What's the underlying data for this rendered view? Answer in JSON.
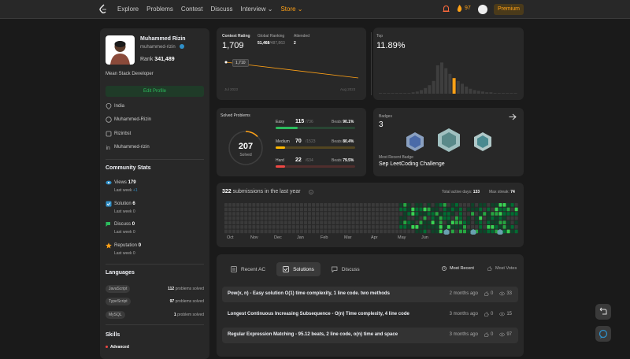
{
  "nav": {
    "links": [
      "Explore",
      "Problems",
      "Contest",
      "Discuss",
      "Interview ⌄",
      "Store ⌄"
    ],
    "streak": "97",
    "premium": "Premium"
  },
  "profile": {
    "name": "Muhammed Rizin",
    "username": "muhammed-rizin",
    "rank_label": "Rank",
    "rank": "341,489",
    "bio": "Mean Stack Developer",
    "edit": "Edit Profile",
    "location": "India",
    "github": "Muhammed-Rizin",
    "twitter": "Rizinbst",
    "linkedin": "Muhammed-rizin"
  },
  "community": {
    "title": "Community Stats",
    "items": [
      {
        "label": "Views",
        "value": "179",
        "sub": "Last week",
        "delta": "+1"
      },
      {
        "label": "Solution",
        "value": "6",
        "sub": "Last week",
        "delta": "0"
      },
      {
        "label": "Discuss",
        "value": "0",
        "sub": "Last week",
        "delta": "0"
      },
      {
        "label": "Reputation",
        "value": "0",
        "sub": "Last week",
        "delta": "0"
      }
    ]
  },
  "languages": {
    "title": "Languages",
    "items": [
      {
        "name": "JavaScript",
        "count": "112",
        "suffix": "problems solved"
      },
      {
        "name": "TypeScript",
        "count": "97",
        "suffix": "problems solved"
      },
      {
        "name": "MySQL",
        "count": "1",
        "suffix": "problem solved"
      }
    ]
  },
  "skills": {
    "title": "Skills",
    "level": "Advanced"
  },
  "contest": {
    "rating_label": "Contest Rating",
    "rating": "1,709",
    "global_label": "Global Ranking",
    "global": "51,468",
    "global_total": "/487,863",
    "attended_label": "Attended",
    "attended": "2",
    "point_label": "1,710",
    "start": "Jul 2023",
    "end": "Aug 2023"
  },
  "top": {
    "label": "Top",
    "value": "11.89%"
  },
  "solved": {
    "title": "Solved Problems",
    "total": "207",
    "sub": "Solved",
    "rows": [
      {
        "name": "Easy",
        "count": "115",
        "of": "/736",
        "beats_label": "Beats",
        "beats": "90.1%",
        "color": "#2cbb5d",
        "fraction": 0.156
      },
      {
        "name": "Medium",
        "count": "70",
        "of": "/1523",
        "beats_label": "Beats",
        "beats": "80.4%",
        "color": "#ffb800",
        "fraction": 0.046
      },
      {
        "name": "Hard",
        "count": "22",
        "of": "/634",
        "beats_label": "Beats",
        "beats": "79.5%",
        "color": "#ef4743",
        "fraction": 0.035
      }
    ]
  },
  "badges": {
    "label": "Badges",
    "count": "3",
    "recent_label": "Most Recent Badge",
    "recent": "Sep LeetCoding Challenge"
  },
  "submissions": {
    "count": "322",
    "text": "submissions in the last year",
    "active_label": "Total active days:",
    "active": "133",
    "streak_label": "Max streak:",
    "streak": "74",
    "months": [
      "Oct",
      "Nov",
      "Dec",
      "Jan",
      "Feb",
      "Mar",
      "Apr",
      "May",
      "Jun"
    ]
  },
  "tabs": {
    "recent": "Recent AC",
    "solutions": "Solutions",
    "discuss": "Discuss",
    "most_recent": "Most Recent",
    "most_votes": "Most Votes"
  },
  "solutions": [
    {
      "title": "Pow(x, n) - Easy solution O(1) time complexity, 1 line code. two methods",
      "time": "2 months ago",
      "likes": "0",
      "views": "33"
    },
    {
      "title": "Longest Continuous Increasing Subsequence - O(n) Time complexity, 4 line code",
      "time": "3 months ago",
      "likes": "0",
      "views": "15"
    },
    {
      "title": "Regular Expression Matching - 95.12 beats, 2 line code, o(n) time and space",
      "time": "3 months ago",
      "likes": "0",
      "views": "97"
    }
  ]
}
